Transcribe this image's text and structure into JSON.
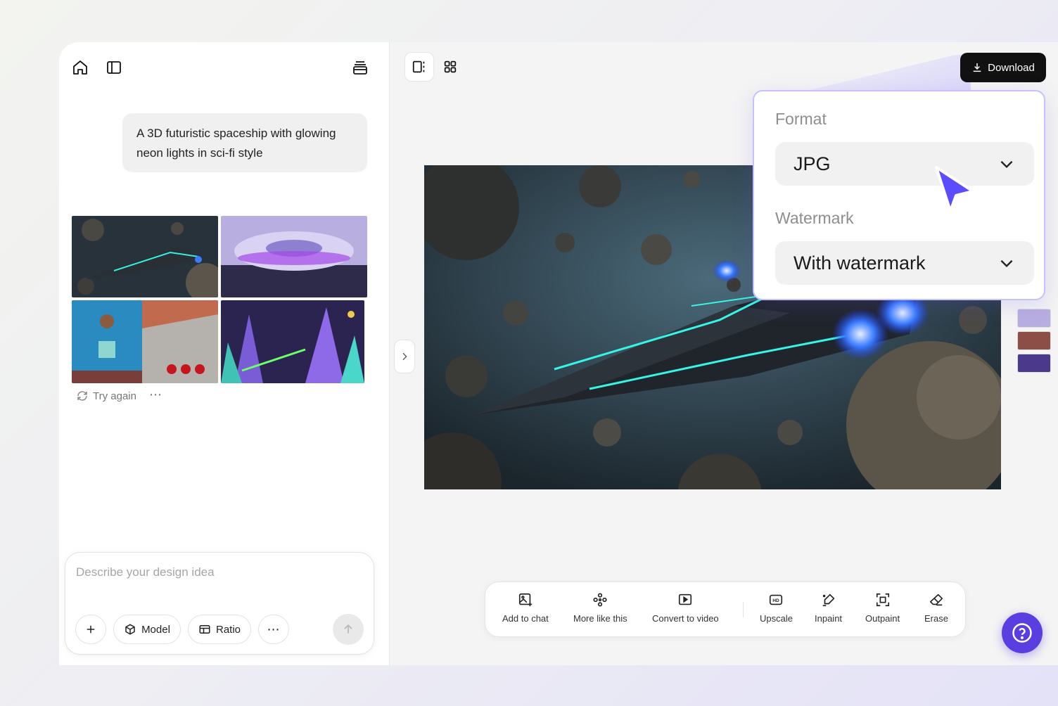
{
  "chat": {
    "prompt": "A 3D futuristic spaceship with glowing neon lights in sci-fi style",
    "try_again": "Try again",
    "more": "⋯",
    "composer_placeholder": "Describe your design idea",
    "model_label": "Model",
    "ratio_label": "Ratio",
    "options": "⋯"
  },
  "toolbar": {
    "items": [
      {
        "label": "Add to chat",
        "icon": "add-image-icon"
      },
      {
        "label": "More like this",
        "icon": "sparkle-icon"
      },
      {
        "label": "Convert to video",
        "icon": "play-icon"
      },
      {
        "label": "Upscale",
        "icon": "hd-icon"
      },
      {
        "label": "Inpaint",
        "icon": "brush-icon"
      },
      {
        "label": "Outpaint",
        "icon": "expand-icon"
      },
      {
        "label": "Erase",
        "icon": "eraser-icon"
      }
    ]
  },
  "download": {
    "label": "Download"
  },
  "download_panel": {
    "format_label": "Format",
    "format_value": "JPG",
    "watermark_label": "Watermark",
    "watermark_value": "With watermark"
  },
  "colors": {
    "accent": "#5a3ee0",
    "popover_border": "#c5c1ff",
    "cursor": "#5b4dff"
  }
}
